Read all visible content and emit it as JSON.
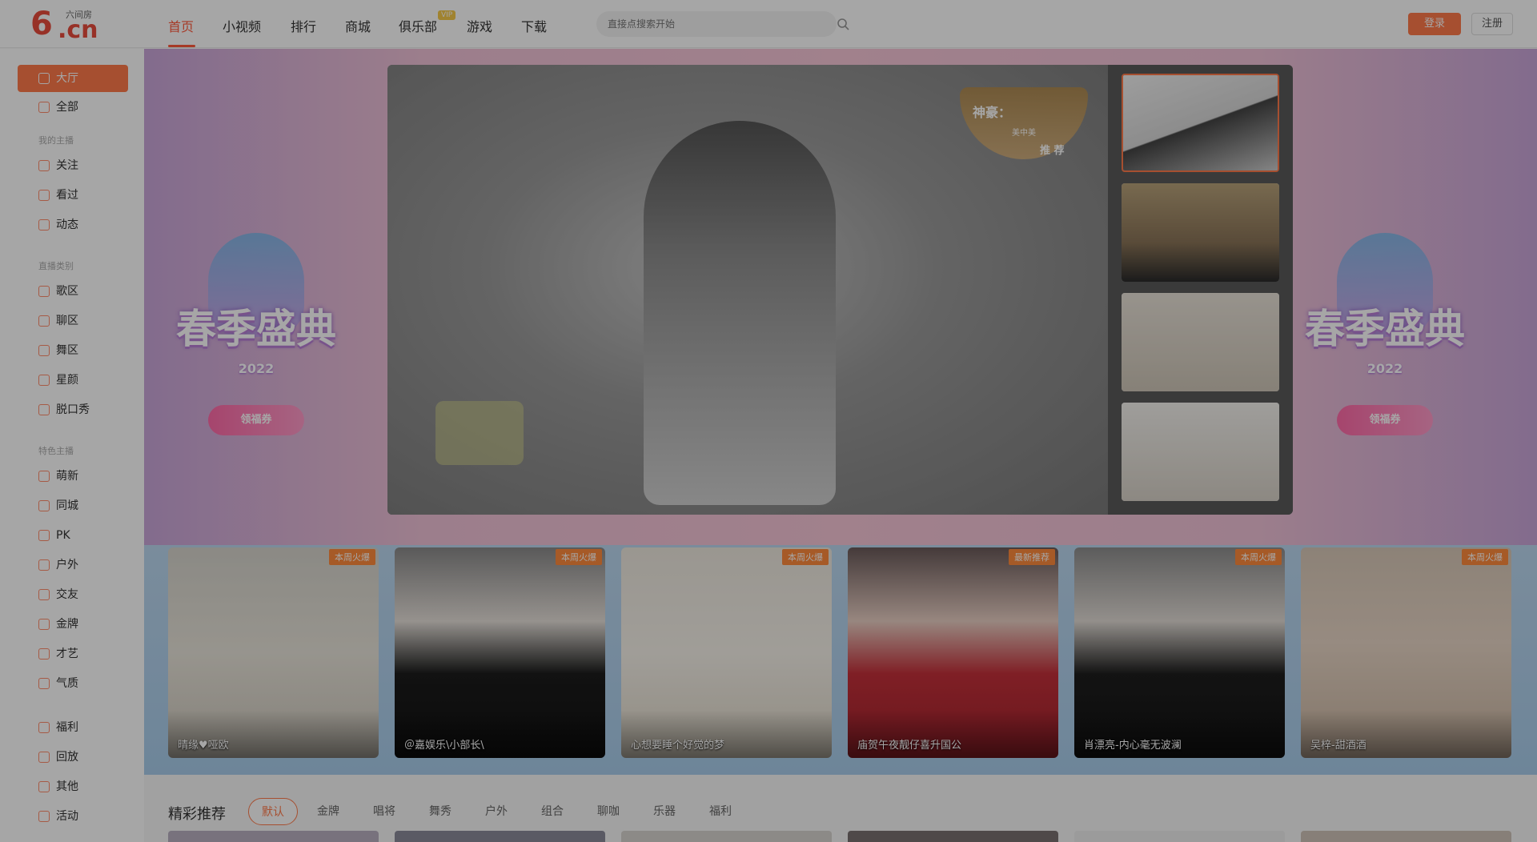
{
  "logo": {
    "mark": "6",
    "text": ".cn",
    "name": "六间房"
  },
  "nav": {
    "items": [
      "首页",
      "小视频",
      "排行",
      "商城",
      "俱乐部",
      "游戏",
      "下载"
    ],
    "vip_badge": "VIP"
  },
  "search": {
    "placeholder": "直接点搜索开始"
  },
  "auth": {
    "login": "登录",
    "register": "注册"
  },
  "sidebar": {
    "items_top": [
      "大厅",
      "全部"
    ],
    "group1_head": "我的主播",
    "group1": [
      "关注",
      "看过",
      "动态"
    ],
    "group2_head": "直播类别",
    "group2": [
      "歌区",
      "聊区",
      "舞区",
      "星颜",
      "脱口秀"
    ],
    "group3_head": "特色主播",
    "group3": [
      "萌新",
      "同城",
      "PK",
      "户外",
      "交友",
      "金牌",
      "才艺",
      "气质"
    ],
    "group4": [
      "福利",
      "回放",
      "其他",
      "活动"
    ]
  },
  "hero": {
    "badge_title": "春季盛典",
    "badge_year": "2022",
    "badge_ribbon": "领福券"
  },
  "player": {
    "crown_title": "神豪：",
    "crown_name": "美中美",
    "crown_tag": "推 荐"
  },
  "cards": [
    {
      "name": "晴缘♥哑欧",
      "tag": "本周火爆"
    },
    {
      "name": "＠嘉娱乐\\小部长\\",
      "tag": "本周火爆"
    },
    {
      "name": "心想要睡个好觉的梦",
      "tag": "本周火爆"
    },
    {
      "name": "庙贺午夜靓仔喜升国公",
      "tag": "最新推荐"
    },
    {
      "name": "肖漂亮-内心毫无波澜",
      "tag": "本周火爆"
    },
    {
      "name": "吴梓-甜酒酒",
      "tag": "本周火爆"
    }
  ],
  "section": {
    "title": "精彩推荐",
    "filters": [
      "默认",
      "金牌",
      "唱将",
      "舞秀",
      "户外",
      "组合",
      "聊咖",
      "乐器",
      "福利"
    ]
  },
  "colors": {
    "accent": "#ff7a4a",
    "nav_active": "#ff5a3c",
    "logo": "#e84c3d"
  }
}
